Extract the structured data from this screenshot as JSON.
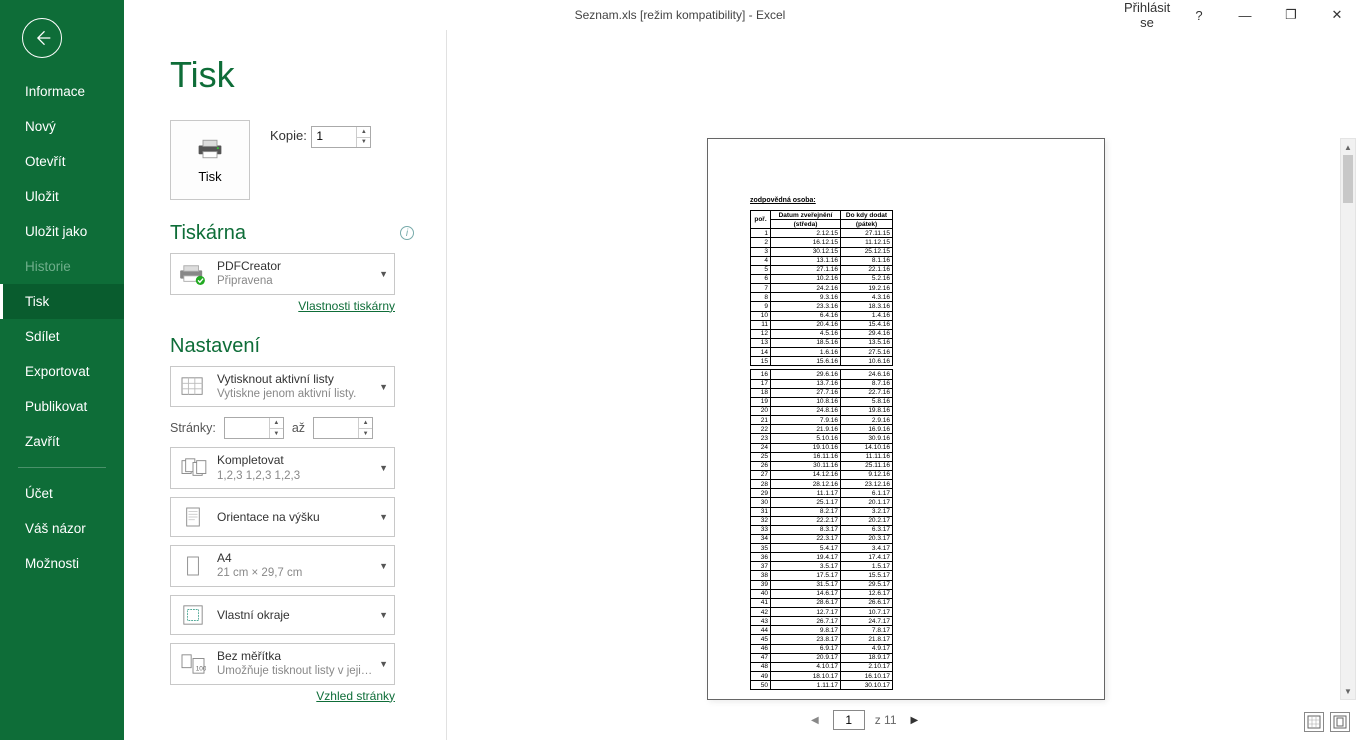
{
  "titlebar": {
    "title": "Seznam.xls  [režim kompatibility]  -  Excel",
    "signin": "Přihlásit se",
    "help": "?",
    "minimize": "—",
    "restore": "❐",
    "close": "✕"
  },
  "sidebar": {
    "items": [
      {
        "label": "Informace",
        "key": "info"
      },
      {
        "label": "Nový",
        "key": "new"
      },
      {
        "label": "Otevřít",
        "key": "open"
      },
      {
        "label": "Uložit",
        "key": "save"
      },
      {
        "label": "Uložit jako",
        "key": "saveas"
      },
      {
        "label": "Historie",
        "key": "history",
        "disabled": true
      },
      {
        "label": "Tisk",
        "key": "print",
        "active": true
      },
      {
        "label": "Sdílet",
        "key": "share"
      },
      {
        "label": "Exportovat",
        "key": "export"
      },
      {
        "label": "Publikovat",
        "key": "publish"
      },
      {
        "label": "Zavřít",
        "key": "close"
      }
    ],
    "footer": [
      {
        "label": "Účet",
        "key": "account"
      },
      {
        "label": "Váš názor",
        "key": "feedback"
      },
      {
        "label": "Možnosti",
        "key": "options"
      }
    ]
  },
  "page": {
    "title": "Tisk",
    "print_button": "Tisk",
    "copies_label": "Kopie:",
    "copies_value": "1",
    "printer_section": "Tiskárna",
    "printer_name": "PDFCreator",
    "printer_status": "Připravena",
    "printer_props_link": "Vlastnosti tiskárny",
    "settings_section": "Nastavení",
    "print_what_title": "Vytisknout aktivní listy",
    "print_what_sub": "Vytiskne jenom aktivní listy.",
    "pages_label": "Stránky:",
    "pages_to": "až",
    "collate_title": "Kompletovat",
    "collate_sub": "1,2,3    1,2,3    1,2,3",
    "orientation": "Orientace na výšku",
    "paper_title": "A4",
    "paper_sub": "21 cm × 29,7 cm",
    "margins": "Vlastní okraje",
    "scaling_title": "Bez měřítka",
    "scaling_sub": "Umožňuje tisknout listy v jeji…",
    "page_setup_link": "Vzhled stránky"
  },
  "pager": {
    "current": "1",
    "total": "z 11"
  },
  "preview": {
    "resp": "zodpovědná osoba:",
    "header1": "poř.",
    "header2a": "Datum zveřejnění",
    "header2b": "(středa)",
    "header3a": "Do kdy dodat",
    "header3b": "(pátek)",
    "rows": [
      [
        "1",
        "2.12.15",
        "27.11.15"
      ],
      [
        "2",
        "16.12.15",
        "11.12.15"
      ],
      [
        "3",
        "30.12.15",
        "25.12.15"
      ],
      [
        "4",
        "13.1.16",
        "8.1.16"
      ],
      [
        "5",
        "27.1.16",
        "22.1.16"
      ],
      [
        "6",
        "10.2.16",
        "5.2.16"
      ],
      [
        "7",
        "24.2.16",
        "19.2.16"
      ],
      [
        "8",
        "9.3.16",
        "4.3.16"
      ],
      [
        "9",
        "23.3.16",
        "18.3.16"
      ],
      [
        "10",
        "6.4.16",
        "1.4.16"
      ],
      [
        "11",
        "20.4.16",
        "15.4.16"
      ],
      [
        "12",
        "4.5.16",
        "29.4.16"
      ],
      [
        "13",
        "18.5.16",
        "13.5.16"
      ],
      [
        "14",
        "1.6.16",
        "27.5.16"
      ],
      [
        "15",
        "15.6.16",
        "10.6.16"
      ],
      [
        "16",
        "29.6.16",
        "24.6.16"
      ],
      [
        "17",
        "13.7.16",
        "8.7.16"
      ],
      [
        "18",
        "27.7.16",
        "22.7.16"
      ],
      [
        "19",
        "10.8.16",
        "5.8.16"
      ],
      [
        "20",
        "24.8.16",
        "19.8.16"
      ],
      [
        "21",
        "7.9.16",
        "2.9.16"
      ],
      [
        "22",
        "21.9.16",
        "16.9.16"
      ],
      [
        "23",
        "5.10.16",
        "30.9.16"
      ],
      [
        "24",
        "19.10.16",
        "14.10.16"
      ],
      [
        "25",
        "16.11.16",
        "11.11.16"
      ],
      [
        "26",
        "30.11.16",
        "25.11.16"
      ],
      [
        "27",
        "14.12.16",
        "9.12.16"
      ],
      [
        "28",
        "28.12.16",
        "23.12.16"
      ],
      [
        "29",
        "11.1.17",
        "6.1.17"
      ],
      [
        "30",
        "25.1.17",
        "20.1.17"
      ],
      [
        "31",
        "8.2.17",
        "3.2.17"
      ],
      [
        "32",
        "22.2.17",
        "20.2.17"
      ],
      [
        "33",
        "8.3.17",
        "6.3.17"
      ],
      [
        "34",
        "22.3.17",
        "20.3.17"
      ],
      [
        "35",
        "5.4.17",
        "3.4.17"
      ],
      [
        "36",
        "19.4.17",
        "17.4.17"
      ],
      [
        "37",
        "3.5.17",
        "1.5.17"
      ],
      [
        "38",
        "17.5.17",
        "15.5.17"
      ],
      [
        "39",
        "31.5.17",
        "29.5.17"
      ],
      [
        "40",
        "14.6.17",
        "12.6.17"
      ],
      [
        "41",
        "28.6.17",
        "26.6.17"
      ],
      [
        "42",
        "12.7.17",
        "10.7.17"
      ],
      [
        "43",
        "26.7.17",
        "24.7.17"
      ],
      [
        "44",
        "9.8.17",
        "7.8.17"
      ],
      [
        "45",
        "23.8.17",
        "21.8.17"
      ],
      [
        "46",
        "6.9.17",
        "4.9.17"
      ],
      [
        "47",
        "20.9.17",
        "18.9.17"
      ],
      [
        "48",
        "4.10.17",
        "2.10.17"
      ],
      [
        "49",
        "18.10.17",
        "16.10.17"
      ],
      [
        "50",
        "1.11.17",
        "30.10.17"
      ]
    ]
  }
}
